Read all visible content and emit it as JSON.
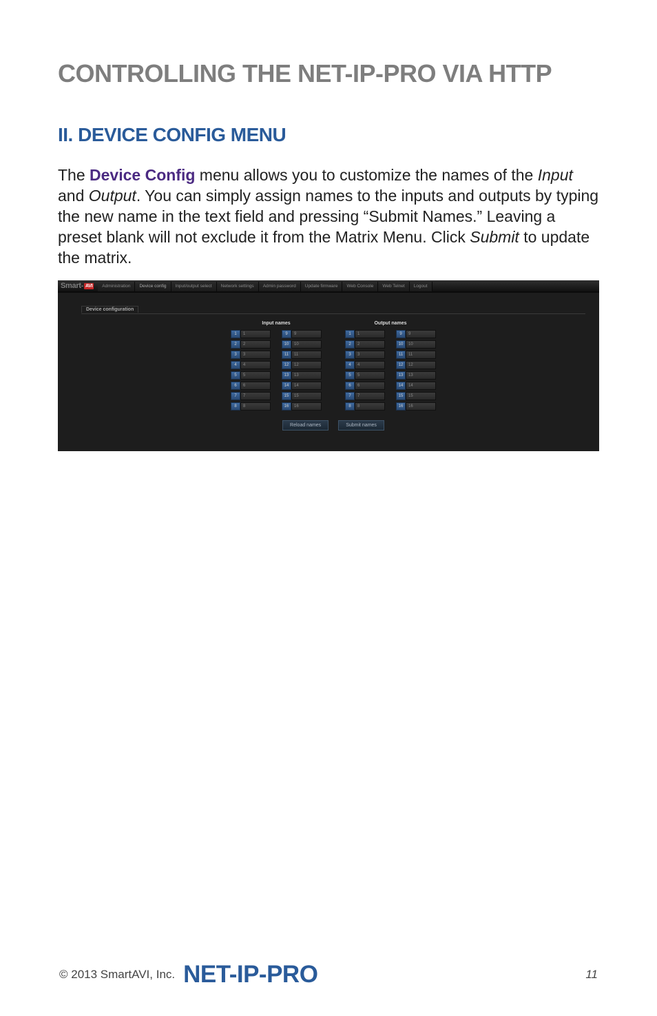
{
  "title": "CONTROLLING THE NET-IP-PRO VIA HTTP",
  "subtitle": "II. DEVICE CONFIG MENU",
  "para_start": "The ",
  "para_device_config": "Device Config",
  "para_after_dc": " menu allows you to customize the names of the ",
  "para_input": "Input",
  "para_between": " and ",
  "para_output": "Output",
  "para_after_output": ". You can simply assign names to the inputs and outputs by typing the new name in the text field and pressing “Submit Names.” Leaving a preset blank will not exclude it from the Matrix Menu. Click ",
  "para_submit": "Submit",
  "para_end": " to update the matrix.",
  "screenshot": {
    "logo": "Smart-",
    "logo_accent": "AVI",
    "tabs": [
      "Administration",
      "Device config",
      "Input/output select",
      "Network settings",
      "Admin password",
      "Update firmware",
      "Web Console",
      "Web Telnet",
      "Logout"
    ],
    "active_tab_index": 1,
    "fieldset_label": "Device configuration",
    "input_names_label": "Input names",
    "output_names_label": "Output names",
    "input_a": [
      {
        "n": "1",
        "v": "1"
      },
      {
        "n": "2",
        "v": "2"
      },
      {
        "n": "3",
        "v": "3"
      },
      {
        "n": "4",
        "v": "4"
      },
      {
        "n": "5",
        "v": "5"
      },
      {
        "n": "6",
        "v": "6"
      },
      {
        "n": "7",
        "v": "7"
      },
      {
        "n": "8",
        "v": "8"
      }
    ],
    "input_b": [
      {
        "n": "9",
        "v": "9"
      },
      {
        "n": "10",
        "v": "10"
      },
      {
        "n": "11",
        "v": "11"
      },
      {
        "n": "12",
        "v": "12"
      },
      {
        "n": "13",
        "v": "13"
      },
      {
        "n": "14",
        "v": "14"
      },
      {
        "n": "15",
        "v": "15"
      },
      {
        "n": "16",
        "v": "16"
      }
    ],
    "output_a": [
      {
        "n": "1",
        "v": "1"
      },
      {
        "n": "2",
        "v": "2"
      },
      {
        "n": "3",
        "v": "3"
      },
      {
        "n": "4",
        "v": "4"
      },
      {
        "n": "5",
        "v": "5"
      },
      {
        "n": "6",
        "v": "6"
      },
      {
        "n": "7",
        "v": "7"
      },
      {
        "n": "8",
        "v": "8"
      }
    ],
    "output_b": [
      {
        "n": "9",
        "v": "9"
      },
      {
        "n": "10",
        "v": "10"
      },
      {
        "n": "11",
        "v": "11"
      },
      {
        "n": "12",
        "v": "12"
      },
      {
        "n": "13",
        "v": "13"
      },
      {
        "n": "14",
        "v": "14"
      },
      {
        "n": "15",
        "v": "15"
      },
      {
        "n": "16",
        "v": "16"
      }
    ],
    "reload_btn": "Reload names",
    "submit_btn": "Submit names"
  },
  "footer": {
    "copyright": "© 2013 SmartAVI, Inc.",
    "product": "NET-IP-PRO",
    "page": "11"
  }
}
